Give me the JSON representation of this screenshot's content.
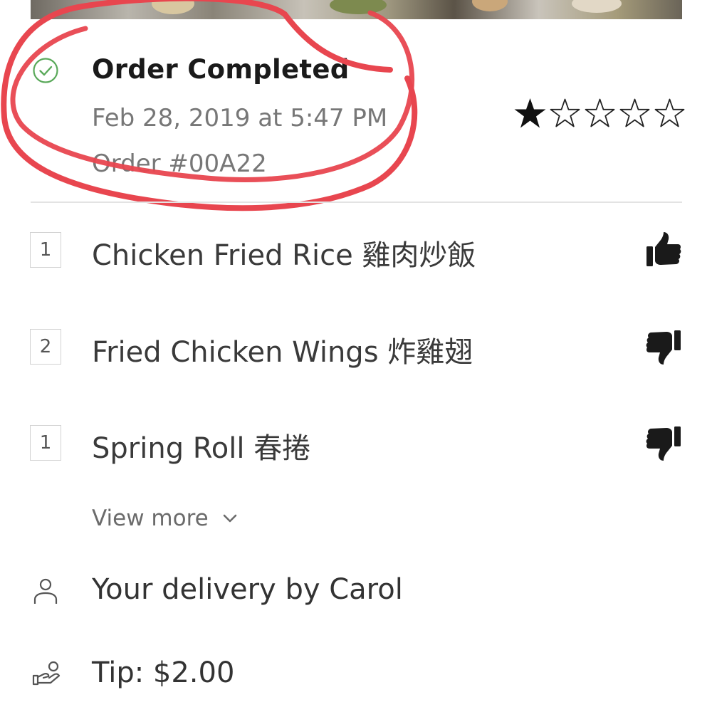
{
  "order": {
    "status": "Order Completed",
    "date": "Feb 28, 2019 at 5:47 PM",
    "number": "Order #00A22",
    "rating": 1,
    "rating_max": 5,
    "status_color": "#5aa95a"
  },
  "items": [
    {
      "qty": "1",
      "name": "Chicken Fried Rice 雞肉炒飯",
      "feedback": "thumbs-up-icon"
    },
    {
      "qty": "2",
      "name": "Fried Chicken Wings 炸雞翅",
      "feedback": "thumbs-down-icon"
    },
    {
      "qty": "1",
      "name": "Spring Roll 春捲",
      "feedback": "thumbs-down-icon"
    }
  ],
  "view_more": {
    "label": "View more",
    "icon": "chevron-down-icon"
  },
  "delivery": {
    "text": "Your delivery by Carol",
    "icon": "person-icon"
  },
  "tip": {
    "text": "Tip: $2.00",
    "icon": "tip-hand-icon"
  },
  "colors": {
    "annotation": "#e8464f",
    "star_filled": "#111111",
    "thumb": "#1a1a1a"
  }
}
